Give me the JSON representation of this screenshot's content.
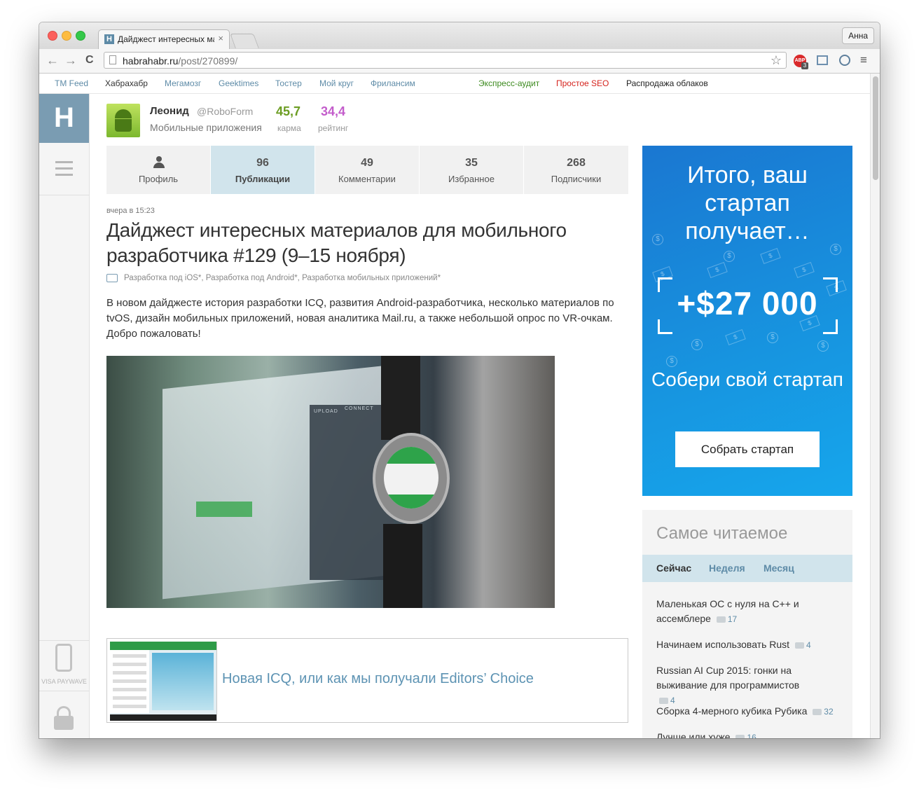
{
  "browser": {
    "tab_title": "Дайджест интересных ма",
    "tab_close": "×",
    "user_button": "Анна",
    "back": "←",
    "forward": "→",
    "reload": "C",
    "url_host": "habrahabr.ru",
    "url_path": "/post/270899/",
    "star": "☆",
    "adblock_label": "ABP",
    "adblock_count": "3",
    "menu": "≡"
  },
  "topnav": {
    "left": [
      "TM Feed",
      "Хабрахабр",
      "Мегамозг",
      "Geektimes",
      "Тостер",
      "Мой круг",
      "Фрилансим"
    ],
    "right": [
      "Экспресс-аудит",
      "Простое SEO",
      "Распродажа облаков"
    ]
  },
  "sidebar": {
    "logo": "H",
    "paywave": "VISA PAYWAVE"
  },
  "author": {
    "name": "Леонид",
    "handle": "@RoboForm",
    "hub": "Мобильные приложения",
    "karma_value": "45,7",
    "karma_label": "карма",
    "rating_value": "34,4",
    "rating_label": "рейтинг"
  },
  "profile_tabs": [
    {
      "label": "Профиль",
      "count": ""
    },
    {
      "label": "Публикации",
      "count": "96"
    },
    {
      "label": "Комментарии",
      "count": "49"
    },
    {
      "label": "Избранное",
      "count": "35"
    },
    {
      "label": "Подписчики",
      "count": "268"
    }
  ],
  "post": {
    "date": "вчера в 15:23",
    "title": "Дайджест интересных материалов для мобильного разработчика #129 (9–15 ноября)",
    "hubs": "Разработка под iOS*, Разработка под Android*, Разработка мобильных приложений*",
    "text": "В новом дайджесте история разработки ICQ, развития Android-разработчика, несколько материалов по tvOS, дизайн мобильных приложений, новая аналитика Mail.ru, а также небольшой опрос по VR-очкам. Добро пожаловать!",
    "image_upload": "UPLOAD",
    "image_connect": "CONNECT"
  },
  "related": {
    "title": "Новая ICQ, или как мы получали Editors’ Choice"
  },
  "ad": {
    "headline": "Итого, ваш стартап получает…",
    "amount": "+$27 000",
    "subline": "Собери свой стартап",
    "button": "Собрать стартап"
  },
  "most_read": {
    "title": "Самое читаемое",
    "tabs": [
      "Сейчас",
      "Неделя",
      "Месяц"
    ],
    "items": [
      {
        "title": "Маленькая ОС с нуля на C++ и ассемблере",
        "comments": "17"
      },
      {
        "title": "Начинаем использовать Rust",
        "comments": "4"
      },
      {
        "title": "Russian AI Cup 2015: гонки на выживание для программистов",
        "comments": "4"
      },
      {
        "title": "Сборка 4-мерного кубика Рубика",
        "comments": "32"
      },
      {
        "title": "Лучше или хуже",
        "comments": "16"
      }
    ]
  },
  "colors": {
    "karma": "#6c9d23",
    "rating": "#c35dcb",
    "link": "#5e8ba7",
    "green_link": "#3c8a1e",
    "red_link": "#d5231d",
    "logo_bg": "#7a9cb2",
    "ad_blue": "#1795e0"
  },
  "icons": [
    "person-icon",
    "briefcase-icon",
    "star-icon",
    "hamburger-icon",
    "lock-icon",
    "phone-icon",
    "comment-icon"
  ]
}
